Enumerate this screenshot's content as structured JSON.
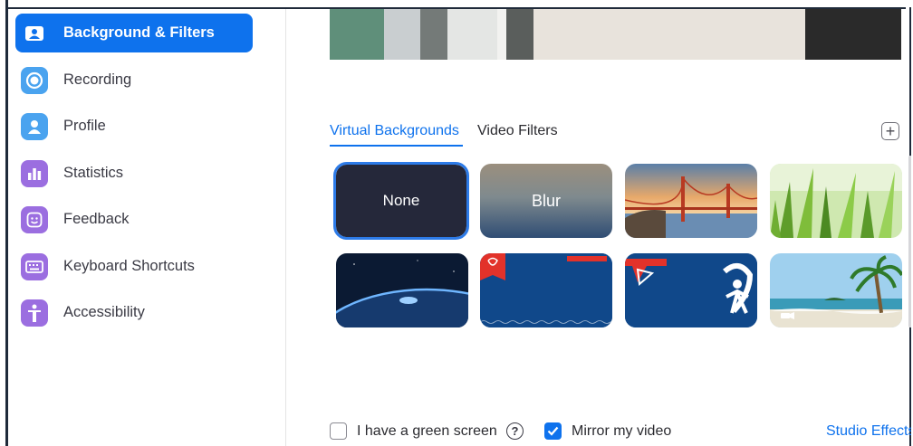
{
  "colors": {
    "accent": "#0e72ed",
    "text": "#3a3a44",
    "sidebar_icon_blue": "#4aa3ef",
    "sidebar_icon_purple": "#9b6ee0"
  },
  "sidebar": {
    "items": [
      {
        "label": "Background & Filters",
        "icon": "person-card-icon",
        "active": true
      },
      {
        "label": "Recording",
        "icon": "record-icon",
        "active": false
      },
      {
        "label": "Profile",
        "icon": "profile-icon",
        "active": false
      },
      {
        "label": "Statistics",
        "icon": "bar-chart-icon",
        "active": false
      },
      {
        "label": "Feedback",
        "icon": "smiley-icon",
        "active": false
      },
      {
        "label": "Keyboard Shortcuts",
        "icon": "keyboard-icon",
        "active": false
      },
      {
        "label": "Accessibility",
        "icon": "accessibility-icon",
        "active": false
      }
    ]
  },
  "tabs": {
    "virtual": "Virtual Backgrounds",
    "filters": "Video Filters",
    "active": "virtual"
  },
  "add_button": {
    "icon": "plus-icon"
  },
  "backgrounds": [
    {
      "name": "none",
      "label": "None",
      "selected": true
    },
    {
      "name": "blur",
      "label": "Blur",
      "selected": false
    },
    {
      "name": "golden-gate",
      "label": "",
      "selected": false
    },
    {
      "name": "grass",
      "label": "",
      "selected": false
    },
    {
      "name": "earth",
      "label": "",
      "selected": false
    },
    {
      "name": "branded-blue-1",
      "label": "",
      "selected": false
    },
    {
      "name": "branded-blue-2",
      "label": "",
      "selected": false
    },
    {
      "name": "beach",
      "label": "",
      "selected": false
    }
  ],
  "options": {
    "green_screen": {
      "label": "I have a green screen",
      "checked": false
    },
    "mirror": {
      "label": "Mirror my video",
      "checked": true
    },
    "studio_effects": "Studio Effects"
  }
}
